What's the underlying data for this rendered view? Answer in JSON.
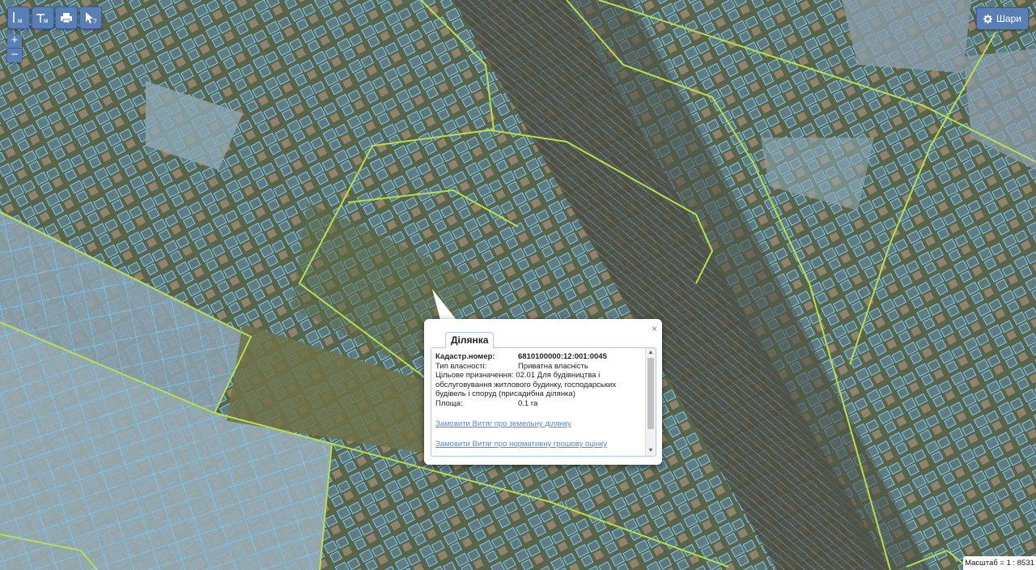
{
  "toolbar": {
    "items": [
      {
        "name": "measure-distance-button",
        "sub": "м"
      },
      {
        "name": "measure-area-button",
        "sub": "м"
      },
      {
        "name": "print-button",
        "sub": ""
      },
      {
        "name": "identify-button",
        "sub": "?"
      }
    ]
  },
  "layers_button": {
    "label": "Шари",
    "icon": "gear-icon"
  },
  "zoom": {
    "in_label": "+",
    "out_label": "−"
  },
  "popup": {
    "tab_label": "Ділянка",
    "close_label": "×",
    "fields": {
      "cadastral_label": "Кадастр.номер:",
      "cadastral_value": "6810100000:12:001:0045",
      "ownership_label": "Тип власності:",
      "ownership_value": "Приватна власність",
      "purpose_label": "Цільове призначення:",
      "purpose_value": "02.01 Для будівництва і обслуговування житлового будинку, господарських будівель і споруд (присадибна ділянка)",
      "area_label": "Площа:",
      "area_value": "0.1 га"
    },
    "links": {
      "extract_land": "Замовити Витяг про земельну ділянку",
      "extract_valuation": "Замовити Витяг про нормативну грошову оцінку"
    }
  },
  "scale": {
    "text": "Масштаб = 1 : 8531"
  },
  "colors": {
    "parcel": "#7fc8f5",
    "boundary": "#b8e04a",
    "button": "#5a7fb5"
  }
}
